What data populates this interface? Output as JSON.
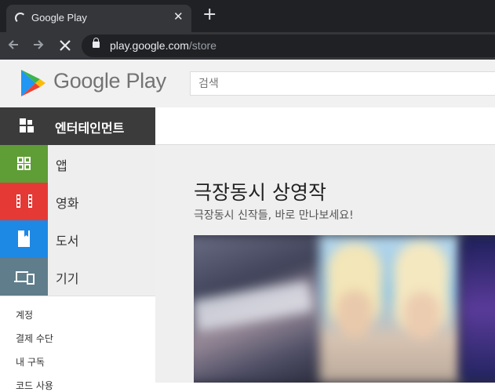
{
  "browser": {
    "tab_title": "Google Play",
    "tab_close": "✕",
    "new_tab": "+",
    "url_host": "play.google.com",
    "url_path": "/store"
  },
  "header": {
    "wordmark": "Google Play",
    "search_placeholder": "검색"
  },
  "sidebar": {
    "categories": [
      {
        "label": "엔터테인먼트",
        "icon": "grid-icon",
        "color": "#3b3b3b"
      },
      {
        "label": "앱",
        "icon": "apps-icon",
        "color": "#5f9d37"
      },
      {
        "label": "영화",
        "icon": "film-icon",
        "color": "#e53935"
      },
      {
        "label": "도서",
        "icon": "book-icon",
        "color": "#1e88e5"
      },
      {
        "label": "기기",
        "icon": "devices-icon",
        "color": "#607d8b"
      }
    ],
    "links": [
      "계정",
      "결제 수단",
      "내 구독",
      "코드 사용"
    ]
  },
  "main": {
    "title": "극장동시 상영작",
    "subtitle": "극장동시 신작들, 바로 만나보세요!"
  }
}
